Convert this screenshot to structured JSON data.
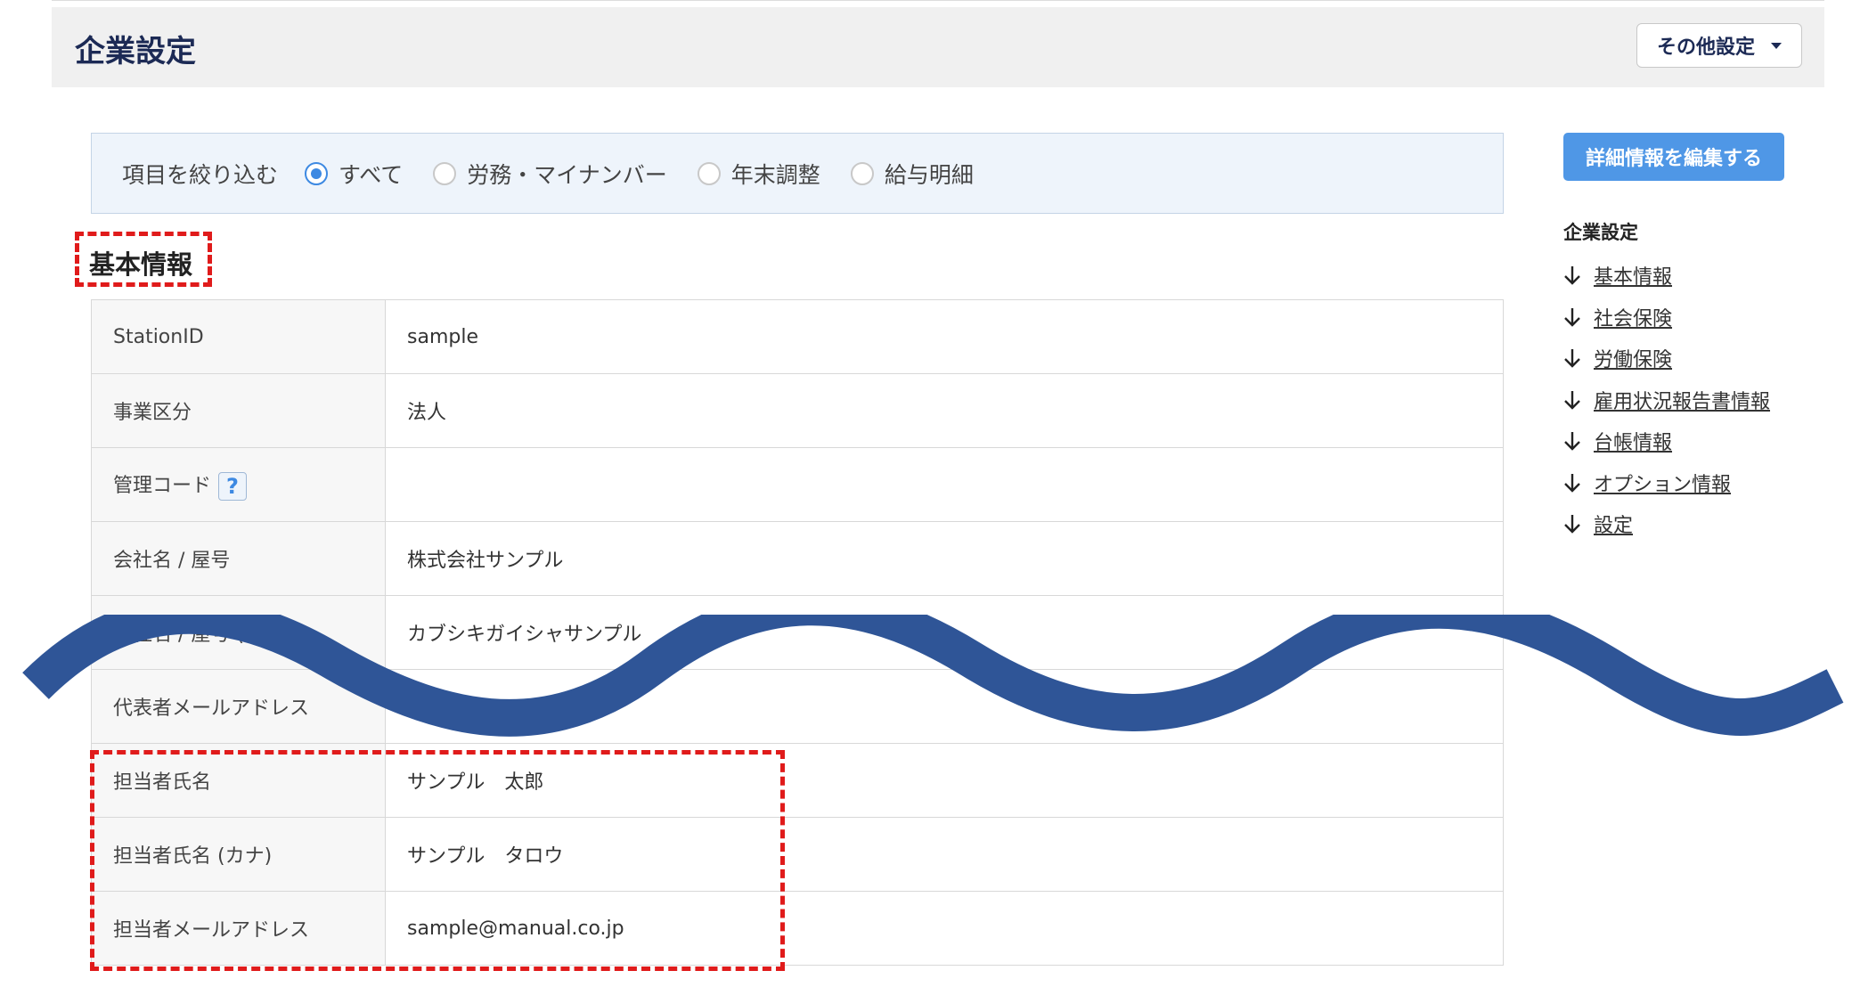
{
  "header": {
    "title": "企業設定",
    "other_settings_label": "その他設定"
  },
  "filter": {
    "label": "項目を絞り込む",
    "options": [
      {
        "label": "すべて",
        "checked": true
      },
      {
        "label": "労務・マイナンバー",
        "checked": false
      },
      {
        "label": "年末調整",
        "checked": false
      },
      {
        "label": "給与明細",
        "checked": false
      }
    ]
  },
  "section": {
    "title": "基本情報"
  },
  "table": {
    "rows": [
      {
        "key": "StationID",
        "value": "sample"
      },
      {
        "key": "事業区分",
        "value": "法人"
      },
      {
        "key": "管理コード",
        "value": ""
      },
      {
        "key": "会社名 / 屋号",
        "value": "株式会社サンプル"
      },
      {
        "key": "会社名 / 屋号 (カナ)",
        "value": "カブシキガイシャサンプル"
      },
      {
        "key": "代表者メールアドレス",
        "value": ""
      },
      {
        "key": "担当者氏名",
        "value": "サンプル　太郎"
      },
      {
        "key": "担当者氏名 (カナ)",
        "value": "サンプル　タロウ"
      },
      {
        "key": "担当者メールアドレス",
        "value": "sample@manual.co.jp"
      }
    ],
    "help_symbol": "?"
  },
  "sidebar": {
    "edit_button_label": "詳細情報を編集する",
    "title": "企業設定",
    "items": [
      "基本情報",
      "社会保険",
      "労働保険",
      "雇用状況報告書情報",
      "台帳情報",
      "オプション情報",
      "設定"
    ]
  },
  "colors": {
    "accent": "#3d89e2",
    "header_text": "#1c2a55",
    "annotation_red": "#e01b1b",
    "wave_blue": "#2f5597"
  }
}
